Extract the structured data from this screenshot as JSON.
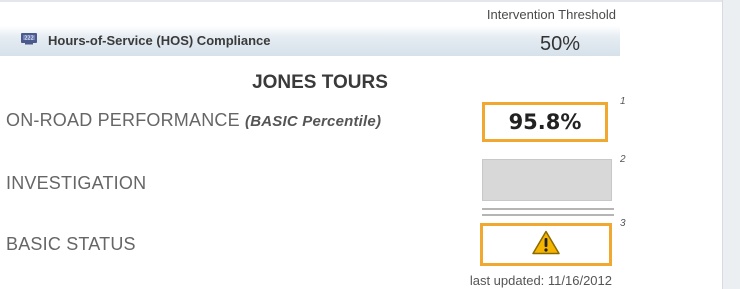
{
  "header": {
    "threshold_label": "Intervention Threshold",
    "threshold_value": "50%",
    "title": "Hours-of-Service (HOS) Compliance",
    "icon": "hos-clock-icon"
  },
  "company": "JONES TOURS",
  "rows": {
    "performance": {
      "label": "ON-ROAD PERFORMANCE",
      "qualifier": "(BASIC Percentile)",
      "value": "95.8%",
      "footnote": "1"
    },
    "investigation": {
      "label": "INVESTIGATION",
      "footnote": "2"
    },
    "status": {
      "label": "BASIC STATUS",
      "footnote": "3",
      "icon": "warning-icon"
    }
  },
  "updated": "last updated: 11/16/2012",
  "colors": {
    "box_border": "#f0a830",
    "banner": "#d6e1ea",
    "warning": "#f4b400"
  }
}
